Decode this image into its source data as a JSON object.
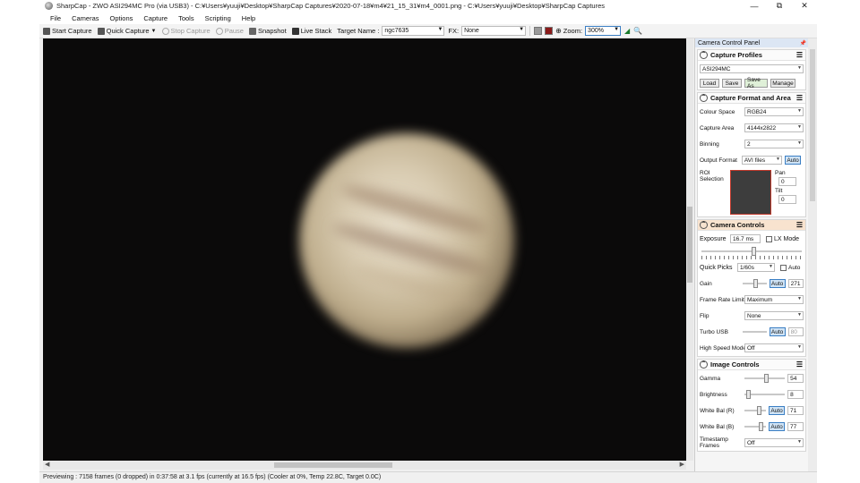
{
  "window": {
    "title": "SharpCap - ZWO ASI294MC Pro (via USB3) - C:¥Users¥yuuji¥Desktop¥SharpCap Captures¥2020-07-18¥m4¥21_15_31¥m4_0001.png - C:¥Users¥yuuji¥Desktop¥SharpCap Captures",
    "minimize": "—",
    "maximize": "⧉",
    "close": "✕"
  },
  "menu": [
    "File",
    "Cameras",
    "Options",
    "Capture",
    "Tools",
    "Scripting",
    "Help"
  ],
  "toolbar": {
    "start_capture": "Start Capture",
    "quick_capture": "Quick Capture",
    "stop_capture": "Stop Capture",
    "pause": "Pause",
    "snapshot": "Snapshot",
    "live_stack": "Live Stack",
    "target_label": "Target Name :",
    "target_value": "ngc7635",
    "fx_label": "FX:",
    "fx_value": "None",
    "zoom_label": "Zoom:",
    "zoom_value": "300%"
  },
  "status": {
    "text": "Previewing : 7158 frames (0 dropped) in 0:37:58 at 3.1 fps  (currently at 16.5 fps) (Cooler at 0%, Temp 22.8C, Target 0.0C)"
  },
  "panel": {
    "header": "Camera Control Panel",
    "pin": "📌",
    "capture_profiles": {
      "title": "Capture Profiles",
      "profile": "ASI294MC",
      "load": "Load",
      "save": "Save",
      "save_as": "Save As",
      "manage": "Manage"
    },
    "capture_format": {
      "title": "Capture Format and Area",
      "colour_space_label": "Colour Space",
      "colour_space_value": "RGB24",
      "capture_area_label": "Capture Area",
      "capture_area_value": "4144x2822",
      "binning_label": "Binning",
      "binning_value": "2",
      "output_format_label": "Output Format",
      "output_format_value": "AVI files",
      "auto": "Auto",
      "roi_label": "ROI Selection",
      "pan_label": "Pan",
      "pan_value": "0",
      "tilt_label": "Tilt",
      "tilt_value": "0"
    },
    "camera_controls": {
      "title": "Camera Controls",
      "exposure_label": "Exposure",
      "exposure_value": "16.7 ms",
      "lx_mode": "LX Mode",
      "quick_picks_label": "Quick Picks",
      "quick_picks_value": "1/60s",
      "auto": "Auto",
      "gain_label": "Gain",
      "gain_value": "271",
      "gain_level": 0.45,
      "frame_rate_label": "Frame Rate Limit",
      "frame_rate_value": "Maximum",
      "flip_label": "Flip",
      "flip_value": "None",
      "turbo_usb_label": "Turbo USB",
      "turbo_usb_value": "80",
      "high_speed_label": "High Speed Mode",
      "high_speed_value": "Off"
    },
    "image_controls": {
      "title": "Image Controls",
      "gamma_label": "Gamma",
      "gamma_value": "54",
      "brightness_label": "Brightness",
      "brightness_value": "8",
      "wb_r_label": "White Bal (R)",
      "wb_r_value": "71",
      "wb_b_label": "White Bal (B)",
      "wb_b_value": "77",
      "auto": "Auto",
      "timestamp_label": "Timestamp Frames",
      "timestamp_value": "Off"
    }
  },
  "colors": {
    "accent": "#3b7fc4",
    "highlight_section": "#f8e3cf",
    "roi_border": "#c0392b"
  }
}
